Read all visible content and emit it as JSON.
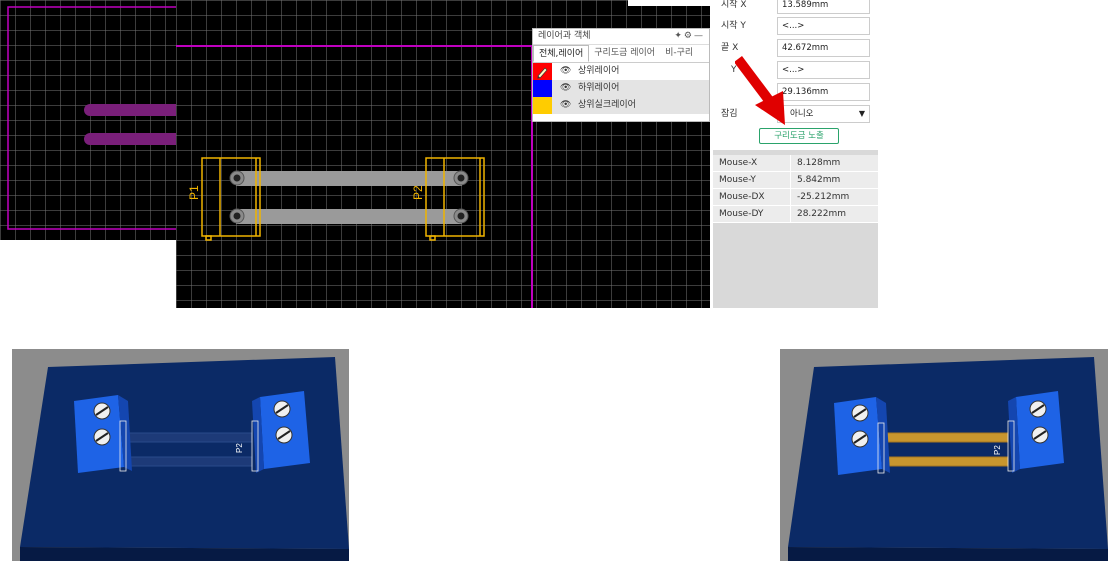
{
  "editor": {
    "designators": [
      "P1",
      "P2"
    ]
  },
  "layers_panel": {
    "title": "레이어과 객체",
    "header_icons": [
      "pin-icon",
      "gear-icon",
      "minimize-icon"
    ],
    "tabs": [
      "전체,레이어",
      "구리도금 레이어",
      "비-구리"
    ],
    "layers": [
      {
        "name": "상위레이어",
        "color": "#ff0000",
        "icon": "pencil-icon"
      },
      {
        "name": "하위레이어",
        "color": "#0000ff"
      },
      {
        "name": "상위실크레이어",
        "color": "#ffcc00"
      }
    ]
  },
  "properties": {
    "rows": [
      {
        "label": "시작 X",
        "value": "13.589mm"
      },
      {
        "label": "시작 Y",
        "value": "<...>"
      },
      {
        "label": "끝 X",
        "value": "42.672mm"
      },
      {
        "label": "Y",
        "value": "<...>"
      },
      {
        "label": "",
        "value": "29.136mm"
      }
    ],
    "lock_label": "잠김",
    "lock_value": "아니오",
    "copper_button": "구리도금 노출"
  },
  "mouse_info": [
    {
      "label": "Mouse-X",
      "value": "8.128mm"
    },
    {
      "label": "Mouse-Y",
      "value": "5.842mm"
    },
    {
      "label": "Mouse-DX",
      "value": "-25.212mm"
    },
    {
      "label": "Mouse-DY",
      "value": "28.222mm"
    }
  ],
  "views_3d": {
    "left_label": "P2",
    "right_label": "P2"
  },
  "colors": {
    "silkscreen": "#f0b400",
    "board_outline": "#c000c0",
    "track_gray": "#9a9a9a",
    "board_3d": "#0b2a66",
    "terminal_blue": "#1e63e6",
    "copper_exposed": "#c8962e",
    "solder_mask_track": "#7a1f7a"
  }
}
